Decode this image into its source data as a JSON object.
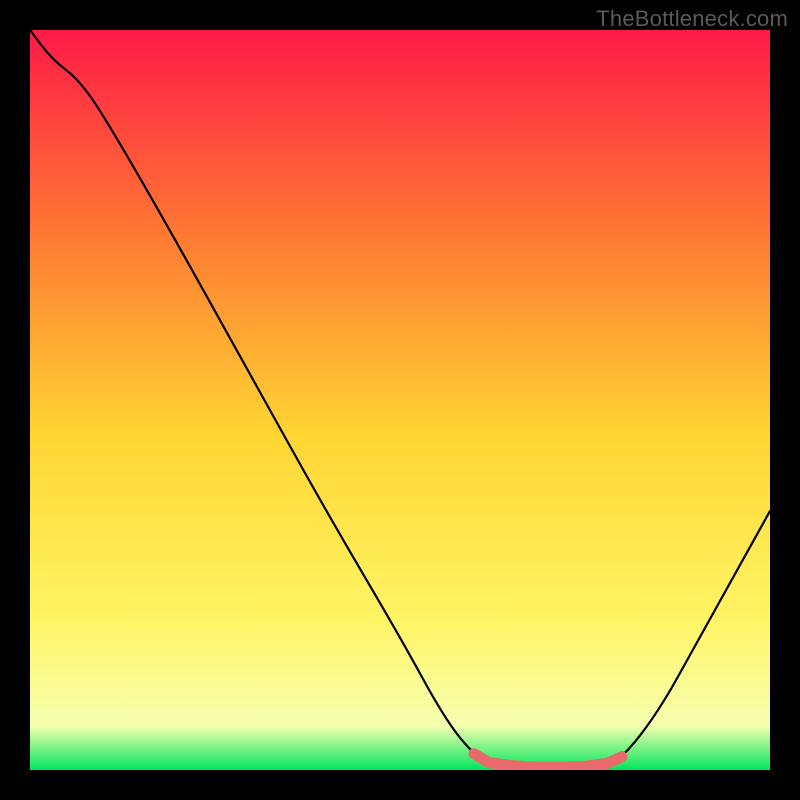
{
  "watermark": "TheBottleneck.com",
  "chart_data": {
    "type": "line",
    "title": "",
    "xlabel": "",
    "ylabel": "",
    "xlim": [
      0,
      100
    ],
    "ylim": [
      0,
      100
    ],
    "background_gradient": {
      "top": "#ff1a47",
      "mid_upper": "#ff7a33",
      "mid": "#ffd633",
      "mid_lower": "#fff566",
      "bottom": "#00e65c"
    },
    "curve": {
      "description": "V-shaped bottleneck curve; high at left, descends to near zero around x≈63-80, rises again toward right",
      "points": [
        {
          "x": 0,
          "y": 100
        },
        {
          "x": 3,
          "y": 96
        },
        {
          "x": 7,
          "y": 93
        },
        {
          "x": 12,
          "y": 85
        },
        {
          "x": 20,
          "y": 71
        },
        {
          "x": 30,
          "y": 53
        },
        {
          "x": 40,
          "y": 35
        },
        {
          "x": 50,
          "y": 18
        },
        {
          "x": 56,
          "y": 7
        },
        {
          "x": 60,
          "y": 2
        },
        {
          "x": 63,
          "y": 0.5
        },
        {
          "x": 70,
          "y": 0.3
        },
        {
          "x": 77,
          "y": 0.5
        },
        {
          "x": 80,
          "y": 1.5
        },
        {
          "x": 85,
          "y": 8
        },
        {
          "x": 90,
          "y": 17
        },
        {
          "x": 95,
          "y": 26
        },
        {
          "x": 100,
          "y": 35
        }
      ]
    },
    "highlight_band": {
      "description": "coral/pink thick segment marking optimal range along the valley floor",
      "color": "#e86a6a",
      "points": [
        {
          "x": 60,
          "y": 2.2
        },
        {
          "x": 62,
          "y": 1.0
        },
        {
          "x": 65,
          "y": 0.6
        },
        {
          "x": 68,
          "y": 0.4
        },
        {
          "x": 72,
          "y": 0.4
        },
        {
          "x": 75,
          "y": 0.5
        },
        {
          "x": 78,
          "y": 0.9
        },
        {
          "x": 80,
          "y": 1.8
        }
      ]
    }
  }
}
